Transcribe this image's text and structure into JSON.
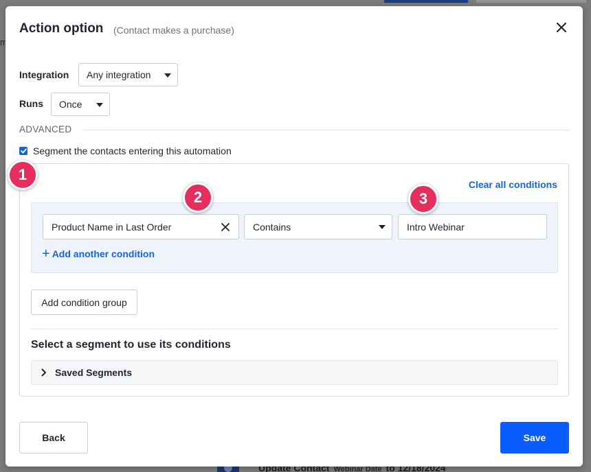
{
  "background": {
    "left_text": "m",
    "update_action": "Update Contact",
    "update_field": "Webinar Date",
    "update_to": "to 12/18/2024"
  },
  "modal": {
    "title": "Action option",
    "subtitle": "(Contact makes a purchase)",
    "close_icon": "close-icon"
  },
  "integration": {
    "label": "Integration",
    "value": "Any integration"
  },
  "runs": {
    "label": "Runs",
    "value": "Once"
  },
  "advanced": {
    "label": "ADVANCED"
  },
  "segment": {
    "checkbox_checked": true,
    "checkbox_label": "Segment the contacts entering this automation",
    "clear_all": "Clear all conditions",
    "condition": {
      "field": "Product Name in Last Order",
      "operator": "Contains",
      "value": "Intro Webinar"
    },
    "add_condition": "Add another condition",
    "add_group": "Add condition group",
    "saved_heading": "Select a segment to use its conditions",
    "saved_segments": "Saved Segments"
  },
  "footer": {
    "back": "Back",
    "save": "Save"
  },
  "markers": [
    "1",
    "2",
    "3"
  ],
  "colors": {
    "primary": "#0a5cff",
    "link": "#1565d8",
    "marker": "#e52e5c"
  }
}
